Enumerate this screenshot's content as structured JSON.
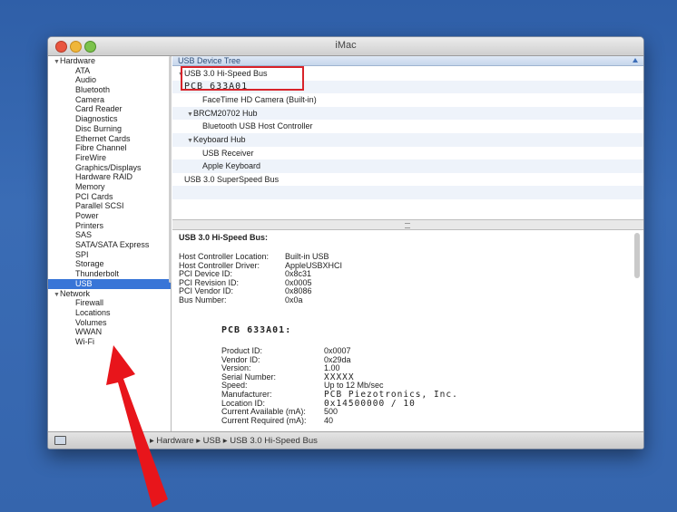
{
  "window": {
    "title": "iMac"
  },
  "sidebar": {
    "items": [
      {
        "label": "Hardware",
        "kind": "header"
      },
      {
        "label": "ATA",
        "kind": "item"
      },
      {
        "label": "Audio",
        "kind": "item"
      },
      {
        "label": "Bluetooth",
        "kind": "item"
      },
      {
        "label": "Camera",
        "kind": "item"
      },
      {
        "label": "Card Reader",
        "kind": "item"
      },
      {
        "label": "Diagnostics",
        "kind": "item"
      },
      {
        "label": "Disc Burning",
        "kind": "item"
      },
      {
        "label": "Ethernet Cards",
        "kind": "item"
      },
      {
        "label": "Fibre Channel",
        "kind": "item"
      },
      {
        "label": "FireWire",
        "kind": "item"
      },
      {
        "label": "Graphics/Displays",
        "kind": "item"
      },
      {
        "label": "Hardware RAID",
        "kind": "item"
      },
      {
        "label": "Memory",
        "kind": "item"
      },
      {
        "label": "PCI Cards",
        "kind": "item"
      },
      {
        "label": "Parallel SCSI",
        "kind": "item"
      },
      {
        "label": "Power",
        "kind": "item"
      },
      {
        "label": "Printers",
        "kind": "item"
      },
      {
        "label": "SAS",
        "kind": "item"
      },
      {
        "label": "SATA/SATA Express",
        "kind": "item"
      },
      {
        "label": "SPI",
        "kind": "item"
      },
      {
        "label": "Storage",
        "kind": "item"
      },
      {
        "label": "Thunderbolt",
        "kind": "item"
      },
      {
        "label": "USB",
        "kind": "item",
        "selected": true
      },
      {
        "label": "Network",
        "kind": "header"
      },
      {
        "label": "Firewall",
        "kind": "item"
      },
      {
        "label": "Locations",
        "kind": "item"
      },
      {
        "label": "Volumes",
        "kind": "item"
      },
      {
        "label": "WWAN",
        "kind": "item"
      },
      {
        "label": "Wi-Fi",
        "kind": "item"
      }
    ]
  },
  "tree": {
    "header": "USB Device Tree",
    "rows": [
      {
        "label": "USB 3.0 Hi-Speed Bus",
        "indent": 0,
        "expanded": true
      },
      {
        "label": "PCB 633A01",
        "indent": 0,
        "mono": true
      },
      {
        "label": "FaceTime HD Camera (Built-in)",
        "indent": 2
      },
      {
        "label": "BRCM20702 Hub",
        "indent": 1,
        "expanded": true
      },
      {
        "label": "Bluetooth USB Host Controller",
        "indent": 2
      },
      {
        "label": "Keyboard Hub",
        "indent": 1,
        "expanded": true
      },
      {
        "label": "USB Receiver",
        "indent": 2
      },
      {
        "label": "Apple Keyboard",
        "indent": 2
      },
      {
        "label": "USB 3.0 SuperSpeed Bus",
        "indent": 0
      },
      {
        "label": "",
        "indent": 0
      },
      {
        "label": "",
        "indent": 0
      }
    ]
  },
  "detail": {
    "title": "USB 3.0 Hi-Speed Bus:",
    "bus_props": [
      {
        "key": "Host Controller Location:",
        "value": "Built-in USB"
      },
      {
        "key": "Host Controller Driver:",
        "value": "AppleUSBXHCI"
      },
      {
        "key": "PCI Device ID:",
        "value": "0x8c31"
      },
      {
        "key": "PCI Revision ID:",
        "value": "0x0005"
      },
      {
        "key": "PCI Vendor ID:",
        "value": "0x8086"
      },
      {
        "key": "Bus Number:",
        "value": "0x0a"
      }
    ],
    "device_title": "PCB 633A01:",
    "device_props": [
      {
        "key": "Product ID:",
        "value": "0x0007"
      },
      {
        "key": "Vendor ID:",
        "value": "0x29da"
      },
      {
        "key": "Version:",
        "value": "1.00"
      },
      {
        "key": "Serial Number:",
        "value": "XXXXX"
      },
      {
        "key": "Speed:",
        "value": "Up to 12 Mb/sec"
      },
      {
        "key": "Manufacturer:",
        "value": "PCB Piezotronics, Inc."
      },
      {
        "key": "Location ID:",
        "value": "0x14500000 / 10"
      },
      {
        "key": "Current Available (mA):",
        "value": "500"
      },
      {
        "key": "Current Required (mA):",
        "value": "40"
      }
    ]
  },
  "statusbar": {
    "breadcrumb": "▸ Hardware ▸ USB ▸ USB 3.0 Hi-Speed Bus",
    "icon": "computer-icon"
  },
  "annotation": {
    "arrow_color": "#e8151b",
    "box_color": "#d8232a"
  }
}
